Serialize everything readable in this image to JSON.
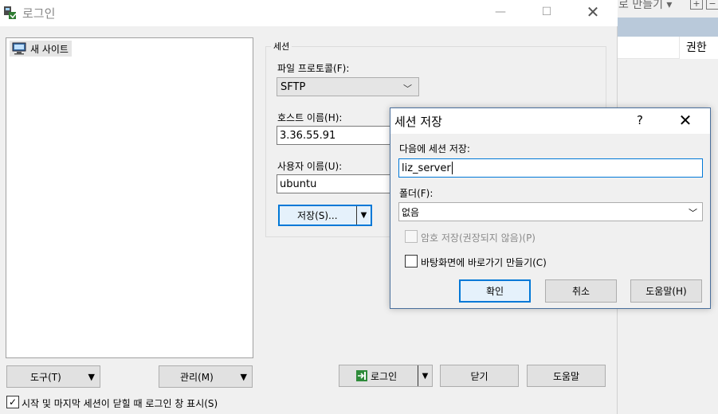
{
  "background_app": {
    "toolbar_text": "로 만들기 ▾",
    "column_header": "권한"
  },
  "login": {
    "title": "로그인",
    "site_tree": {
      "item_label": "새 사이트"
    },
    "session_group": {
      "label": "세션",
      "protocol_label": "파일 프로토콜(F):",
      "protocol_value": "SFTP",
      "host_label": "호스트 이름(H):",
      "host_value": "3.36.55.91",
      "user_label": "사용자 이름(U):",
      "user_value": "ubuntu",
      "save_button": "저장(S)..."
    },
    "tools_button": "도구(T)",
    "manage_button": "관리(M)",
    "login_button": "로그인",
    "close_button": "닫기",
    "help_button": "도움말",
    "show_on_startup": "시작 및 마지막 세션이 닫힐 때 로그인 창 표시(S)",
    "show_on_startup_checked": true
  },
  "save_dialog": {
    "title": "세션 저장",
    "help_symbol": "?",
    "close_symbol": "✕",
    "name_label": "다음에 세션 저장:",
    "name_value": "liz_server",
    "folder_label": "폴더(F):",
    "folder_value": "없음",
    "save_password_label": "암호 저장(권장되지 않음)(P)",
    "save_password_checked": false,
    "desktop_shortcut_label": "바탕화면에 바로가기 만들기(C)",
    "desktop_shortcut_checked": false,
    "ok_button": "확인",
    "cancel_button": "취소",
    "help_button": "도움말(H)"
  },
  "icons": {
    "app_icon": "winscp-icon",
    "site_icon": "computer-icon",
    "login_icon": "login-icon",
    "check_mark": "✓"
  }
}
